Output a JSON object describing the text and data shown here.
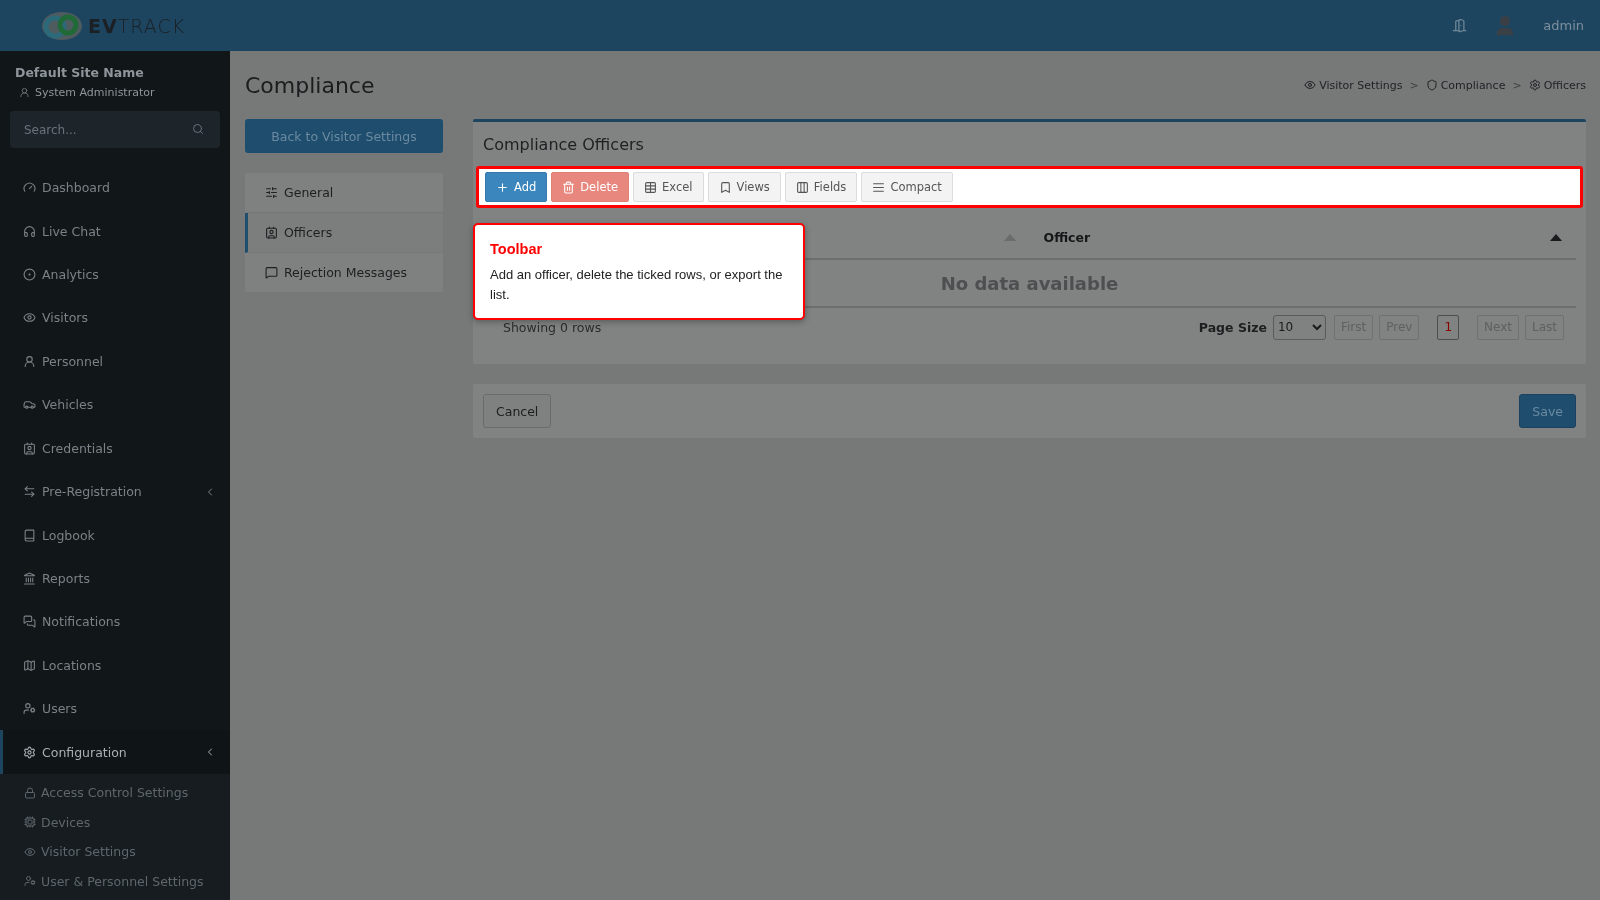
{
  "header": {
    "logo": "**EV**TRACK",
    "user": "admin"
  },
  "sidebar": {
    "site_name": "Default Site Name",
    "role": "System Administrator",
    "search": {
      "placeholder": "Search..."
    },
    "items": [
      {
        "label": "Dashboard",
        "kind": "link",
        "selected": false
      },
      {
        "label": "Live Chat",
        "kind": "link",
        "selected": false
      },
      {
        "label": "Analytics",
        "kind": "link",
        "selected": false
      },
      {
        "label": "Visitors",
        "kind": "link",
        "selected": false
      },
      {
        "label": "Personnel",
        "kind": "link",
        "selected": false
      },
      {
        "label": "Vehicles",
        "kind": "link",
        "selected": false
      },
      {
        "label": "Credentials",
        "kind": "link",
        "selected": false
      },
      {
        "label": "Pre-Registration",
        "kind": "group",
        "selected": false
      },
      {
        "label": "Logbook",
        "kind": "link",
        "selected": false
      },
      {
        "label": "Reports",
        "kind": "link",
        "selected": false
      },
      {
        "label": "Notifications",
        "kind": "link",
        "selected": false
      },
      {
        "label": "Locations",
        "kind": "link",
        "selected": false
      },
      {
        "label": "Users",
        "kind": "link",
        "selected": false
      },
      {
        "label": "Configuration",
        "kind": "group",
        "selected": true,
        "expanded": true,
        "children": [
          {
            "label": "Access Control Settings"
          },
          {
            "label": "Devices"
          },
          {
            "label": "Visitor Settings"
          },
          {
            "label": "User & Personnel Settings"
          }
        ]
      }
    ]
  },
  "page": {
    "title": "Compliance",
    "back_button": "Back to Visitor Settings",
    "breadcrumb": [
      {
        "kind": "link",
        "label": "Visitor Settings"
      },
      {
        "kind": "sep",
        "label": ">"
      },
      {
        "kind": "link",
        "label": "Compliance"
      },
      {
        "kind": "sep",
        "label": ">"
      },
      {
        "kind": "link",
        "label": "Officers"
      }
    ],
    "tabs": [
      {
        "label": "General",
        "selected": false
      },
      {
        "label": "Officers",
        "selected": true
      },
      {
        "label": "Rejection Messages",
        "selected": false
      }
    ]
  },
  "panel": {
    "title": "Compliance Officers",
    "toolbar": [
      {
        "label": "Add",
        "kind": "primary"
      },
      {
        "label": "Delete",
        "kind": "danger"
      },
      {
        "label": "Excel",
        "kind": "default"
      },
      {
        "label": "Views",
        "kind": "default"
      },
      {
        "label": "Fields",
        "kind": "default"
      },
      {
        "label": "Compact",
        "kind": "default"
      }
    ],
    "table": {
      "columns": [
        {
          "sorted": false
        },
        {
          "label": "Officer",
          "sorted": true
        }
      ],
      "empty_message": "No data available"
    },
    "footer": {
      "summary": "Showing 0 rows",
      "page_size_label": "Page Size",
      "page_size": "10",
      "pager": [
        {
          "label": "First",
          "disabled": true,
          "selected": false
        },
        {
          "label": "Prev",
          "disabled": true,
          "selected": false
        },
        {
          "label": "1",
          "disabled": false,
          "selected": true
        },
        {
          "label": "Next",
          "disabled": true,
          "selected": false
        },
        {
          "label": "Last",
          "disabled": true,
          "selected": false
        }
      ]
    }
  },
  "actions": {
    "cancel": "Cancel",
    "save": "Save"
  },
  "tour": {
    "title": "Toolbar",
    "text": "Add an officer, delete the ticked rows, or export the list."
  }
}
